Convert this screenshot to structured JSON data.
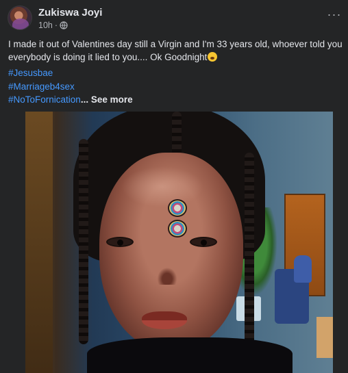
{
  "post": {
    "author": "Zukiswa Joyi",
    "timestamp": "10h",
    "separator": "·",
    "audience_icon": "globe-icon",
    "more_icon": "more-options-icon",
    "more_label": "···",
    "text": "I made it out of Valentines day still a Virgin and I'm 33 years old, whoever told you everybody is doing it lied to you.... Ok Goodnight",
    "emoji_icon": "yawning-face-emoji",
    "hashtags": [
      "#Jesusbae",
      "#Marriageb4sex",
      "#NoToFornication"
    ],
    "see_more_label": "... See more",
    "photo_icon": "post-photo"
  },
  "colors": {
    "background": "#242526",
    "text": "#e4e6eb",
    "secondary_text": "#b0b3b8",
    "link": "#4599ff"
  }
}
